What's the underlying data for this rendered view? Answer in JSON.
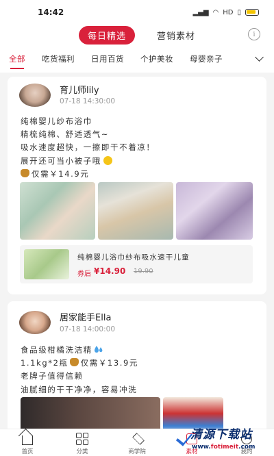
{
  "status_bar": {
    "time": "14:42",
    "network": "HD",
    "battery_color": "#f4c400"
  },
  "top_tabs": {
    "active": "每日精选",
    "other": "营销素材",
    "info_icon": "i"
  },
  "categories": {
    "items": [
      "全部",
      "吃货福利",
      "日用百货",
      "个护美妆",
      "母婴亲子"
    ],
    "active_index": 0,
    "more_icon": "chevron-down-icon"
  },
  "posts": [
    {
      "user": "育儿师lily",
      "time": "07-18 14:30:00",
      "lines": [
        "纯棉婴儿纱布浴巾",
        "精梳纯棉、舒适透气~",
        "吸水速度超快，一擦即干不着凉！",
        "展开还可当小被子哦"
      ],
      "price_line": "仅需￥14.9元",
      "product": {
        "title": "纯棉婴儿浴巾纱布吸水速干儿童",
        "price_label": "券后",
        "price": "¥14.90",
        "original_price": "19.90"
      }
    },
    {
      "user": "居家能手Ella",
      "time": "07-18 14:00:00",
      "lines": [
        "食品级柑橘洗洁精",
        "老牌子值得信赖",
        "油腻细的干干净净，容易冲洗"
      ],
      "price_line": "1.1kg*2瓶",
      "price_suffix": "仅需￥13.9元"
    }
  ],
  "bottom_nav": {
    "items": [
      {
        "label": "首页",
        "icon": "home-icon"
      },
      {
        "label": "分类",
        "icon": "grid-icon"
      },
      {
        "label": "商学院",
        "icon": "graduation-cap-icon"
      },
      {
        "label": "素材",
        "icon": "material-icon"
      },
      {
        "label": "我的",
        "icon": "user-icon"
      }
    ],
    "active_index": 3
  },
  "watermark": {
    "title": "清源下载站",
    "url_prefix": "www.",
    "url_main": "fotimeit",
    "url_suffix": ".com"
  },
  "colors": {
    "accent": "#d9213b",
    "background": "#f4f4f4",
    "watermark_blue": "#0a2d6e"
  }
}
